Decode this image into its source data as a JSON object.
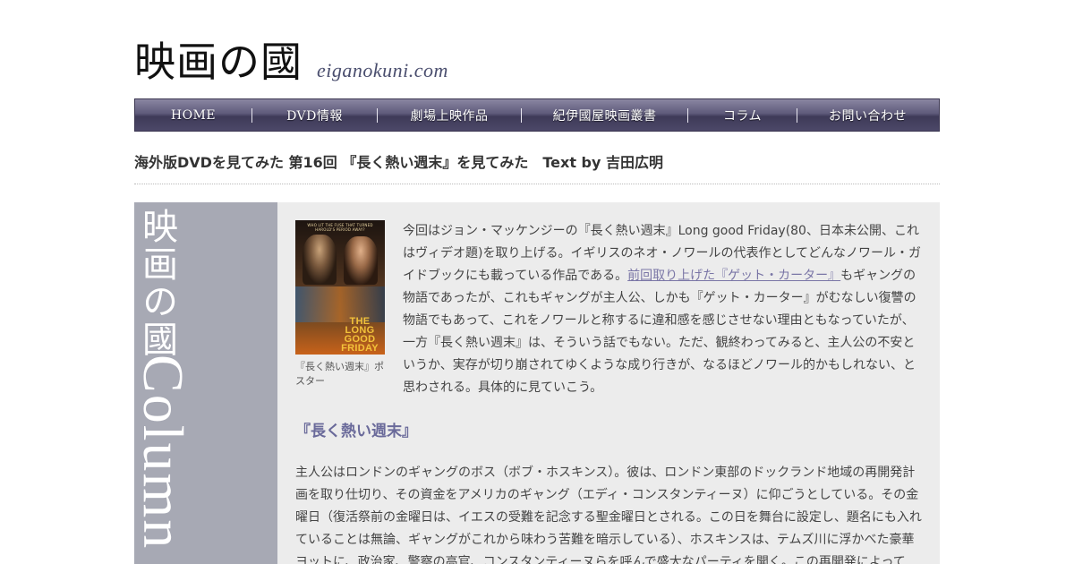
{
  "header": {
    "logo_main": "映画の國",
    "logo_sub": "eiganokuni.com"
  },
  "nav": {
    "items": [
      {
        "label": "HOME"
      },
      {
        "label": "DVD情報"
      },
      {
        "label": "劇場上映作品"
      },
      {
        "label": "紀伊國屋映画叢書"
      },
      {
        "label": "コラム"
      },
      {
        "label": "お問い合わせ"
      }
    ]
  },
  "page": {
    "title": "海外版DVDを見てみた 第16回 『長く熱い週末』を見てみた　Text by 吉田広明"
  },
  "sidebar": {
    "title_jp": "映画の國",
    "title_en": "Column"
  },
  "article": {
    "poster": {
      "tagline": "WHO LIT THE FUSE THAT TURNED HAROLD'S PERIOD AWAY?",
      "title": "THE LONG GOOD FRIDAY",
      "caption": "『長く熱い週末』ポスター"
    },
    "intro_before": "今回はジョン・マッケンジーの『長く熱い週末』Long good Friday(80、日本未公開、これはヴィデオ題)を取り上げる。イギリスのネオ・ノワールの代表作としてどんなノワール・ガイドブックにも載っている作品である。",
    "intro_link": "前回取り上げた『ゲット・カーター』",
    "intro_after": "もギャングの物語であったが、これもギャングが主人公、しかも『ゲット・カーター』がむなしい復讐の物語でもあって、これをノワールと称するに違和感を感じさせない理由ともなっていたが、一方『長く熱い週末』は、そういう話でもない。ただ、観終わってみると、主人公の不安というか、実存が切り崩されてゆくような成り行きが、なるほどノワール的かもしれない、と思わされる。具体的に見ていこう。",
    "section_heading": "『長く熱い週末』",
    "body": "主人公はロンドンのギャングのボス（ボブ・ホスキンス）。彼は、ロンドン東部のドックランド地域の再開発計画を取り仕切り、その資金をアメリカのギャング（エディ・コンスタンティーヌ）に仰ごうとしている。その金曜日（復活祭前の金曜日は、イエスの受難を記念する聖金曜日とされる。この日を舞台に設定し、題名にも入れていることは無論、ギャングがこれから味わう苦難を暗示している）、ホスキンスは、テムズ川に浮かべた豪華ヨットに、政治家、警察の高官、コンスタンティーヌらを呼んで盛大なパーティを開く。この再開発によって"
  },
  "colors": {
    "nav_bg": "#5e5a7a",
    "sidebar_bg": "#a7a9b4",
    "content_bg": "#ececec",
    "link": "#7a76a6",
    "heading": "#6a6a9a"
  }
}
